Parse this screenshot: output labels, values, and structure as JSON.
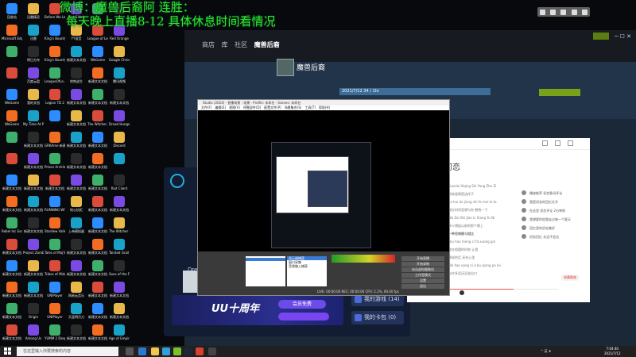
{
  "overlay": {
    "line1": "微博：魔兽后裔阿        连胜：",
    "line2": "每天晚上直播8-12  具体休息时间看情况"
  },
  "desktop_icons": [
    [
      "回收站",
      "迅雷精灵",
      "Before We Leave",
      "Riot Client",
      "",
      ""
    ],
    [
      "Microsoft Edge",
      "迅雷",
      "King's Bounty II",
      "YY语音",
      "League of Legends",
      "Red Orange"
    ],
    [
      "",
      "明日方舟",
      "King's Bounty II",
      "新建文本文档",
      "WeGame",
      "Google Chrome"
    ],
    [
      "",
      "百度云盘",
      "LeagueOfLe...",
      "地铁逃生",
      "新建文本文档",
      "腾讯视频"
    ],
    [
      "WeGame",
      "我的文档",
      "Legion TD 2",
      "新建文本文档",
      "新建文本文档",
      "新建文本文档"
    ],
    [
      "WeGame",
      "My Time At Portia",
      "",
      "新建文本文档",
      "The Witcher 3",
      "Dread Hunger"
    ],
    [
      "",
      "新建文本文档",
      "GRKAme 新建文本",
      "新建文本文档",
      "新建文本文档",
      "Discord"
    ],
    [
      "",
      "新建文本文档",
      "Prison Architect",
      "新建文本文档",
      "新建文本文档",
      ""
    ],
    [
      "新建文本文档",
      "新建文本文档",
      "新建文本文档",
      "新建文本文档",
      "新建文本文档",
      "Riot Client"
    ],
    [
      "新建文本文档",
      "新建文本文档",
      "RUNNING WITH RI...",
      "地心抗拒",
      "新建文本文档",
      "新建文本文档"
    ],
    [
      "Rebel Inc Escalation",
      "新建文本文档",
      "Stardew Valley",
      "上帝模拟器",
      "新建文本文档",
      "The Witcher 3"
    ],
    [
      "新建文本文档",
      "Project Zomboid",
      "Tales of Maj'Eyal",
      "新建文本文档",
      "新建文本文档",
      "Tainted Grail Co..."
    ],
    [
      "新建文本文档",
      "新建文本文档",
      "Tribes of Midgard",
      "新建文本文档",
      "新建文本文档",
      "Sons of the Forest"
    ],
    [
      "新建文本文档",
      "新建文本文档",
      "UNIPlayer",
      "网易云音乐",
      "新建文本文档",
      "新建文本文档"
    ],
    [
      "新建文本文档",
      "Origin",
      "UNIPlayer",
      "天涯明月刀",
      "新建文本文档",
      "新建文本文档"
    ],
    [
      "新建文本文档",
      "Among Us",
      "YUMM 2 Despair...",
      "新建文本文档",
      "新建文本文档",
      "Age of Empires IV"
    ]
  ],
  "steam": {
    "nav": [
      "商店",
      "库",
      "社区",
      "魔兽后裔"
    ],
    "user_name": "魔兽后裔",
    "row_text": "2021/7/12  34 / 1hr"
  },
  "obs": {
    "title": "Studio (2024) - 直播场景 - 场景 - Profile: 未命名 - Scenes: 未命名",
    "menu": [
      "文件(F)",
      "编辑(E)",
      "视图(V)",
      "停靠部件(D)",
      "配置文件(P)",
      "场景集合(S)",
      "工具(T)",
      "帮助(H)"
    ],
    "sources": [
      "显示器捕获",
      "窗口采集",
      "音频输入捕获"
    ],
    "controls": [
      "开始直播",
      "开始录制",
      "启动虚拟摄像机",
      "工作室模式",
      "设置",
      "退出"
    ],
    "status": "LIVE: 00:00:00   REC: 00:00:00   CPU: 2.1%, 60.00 fps"
  },
  "game": {
    "label": "Dread",
    "banner_brand": "UU十周年",
    "banner_pill": "会员免费",
    "side_buttons": [
      "我的游戏 (14)",
      "我的卡包 (0)"
    ]
  },
  "music": {
    "song_title": "初恋",
    "lyrics": [
      "Yuanlai Aiqing Shi Yang Zhe Zi",
      "原来爱情是这样子",
      "ya hui de jiang shi fa mei le ta",
      "我在时间里想与你 拥抱一下",
      "Wo Zai Shi Jian Li Xiang Yu Ni",
      "多少想起以前的那个晚上",
      "一种思绪缠与相比",
      "You hao meng ci fa xuong gin",
      "能在相遇的时刻 让我",
      "想说的话 还在心里",
      "Wo hao yong ni a bu qiang pa lei",
      "有许多话还没说出口"
    ],
    "comments": [
      "播放推荐  初恋歌词评论",
      "我是初恋的回忆文字",
      "在这里  初恋评论 2分钟前",
      "我想要你陪我走过每一个夏天",
      "回忆里的初恋美好",
      "初恋回忆 永远不会忘"
    ],
    "like_button": "收藏歌曲"
  },
  "taskbar": {
    "search_placeholder": "在这里输入你要搜索的内容",
    "time": "7:04:40",
    "date": "2021/7/12",
    "tray": "^  英  ♦"
  }
}
